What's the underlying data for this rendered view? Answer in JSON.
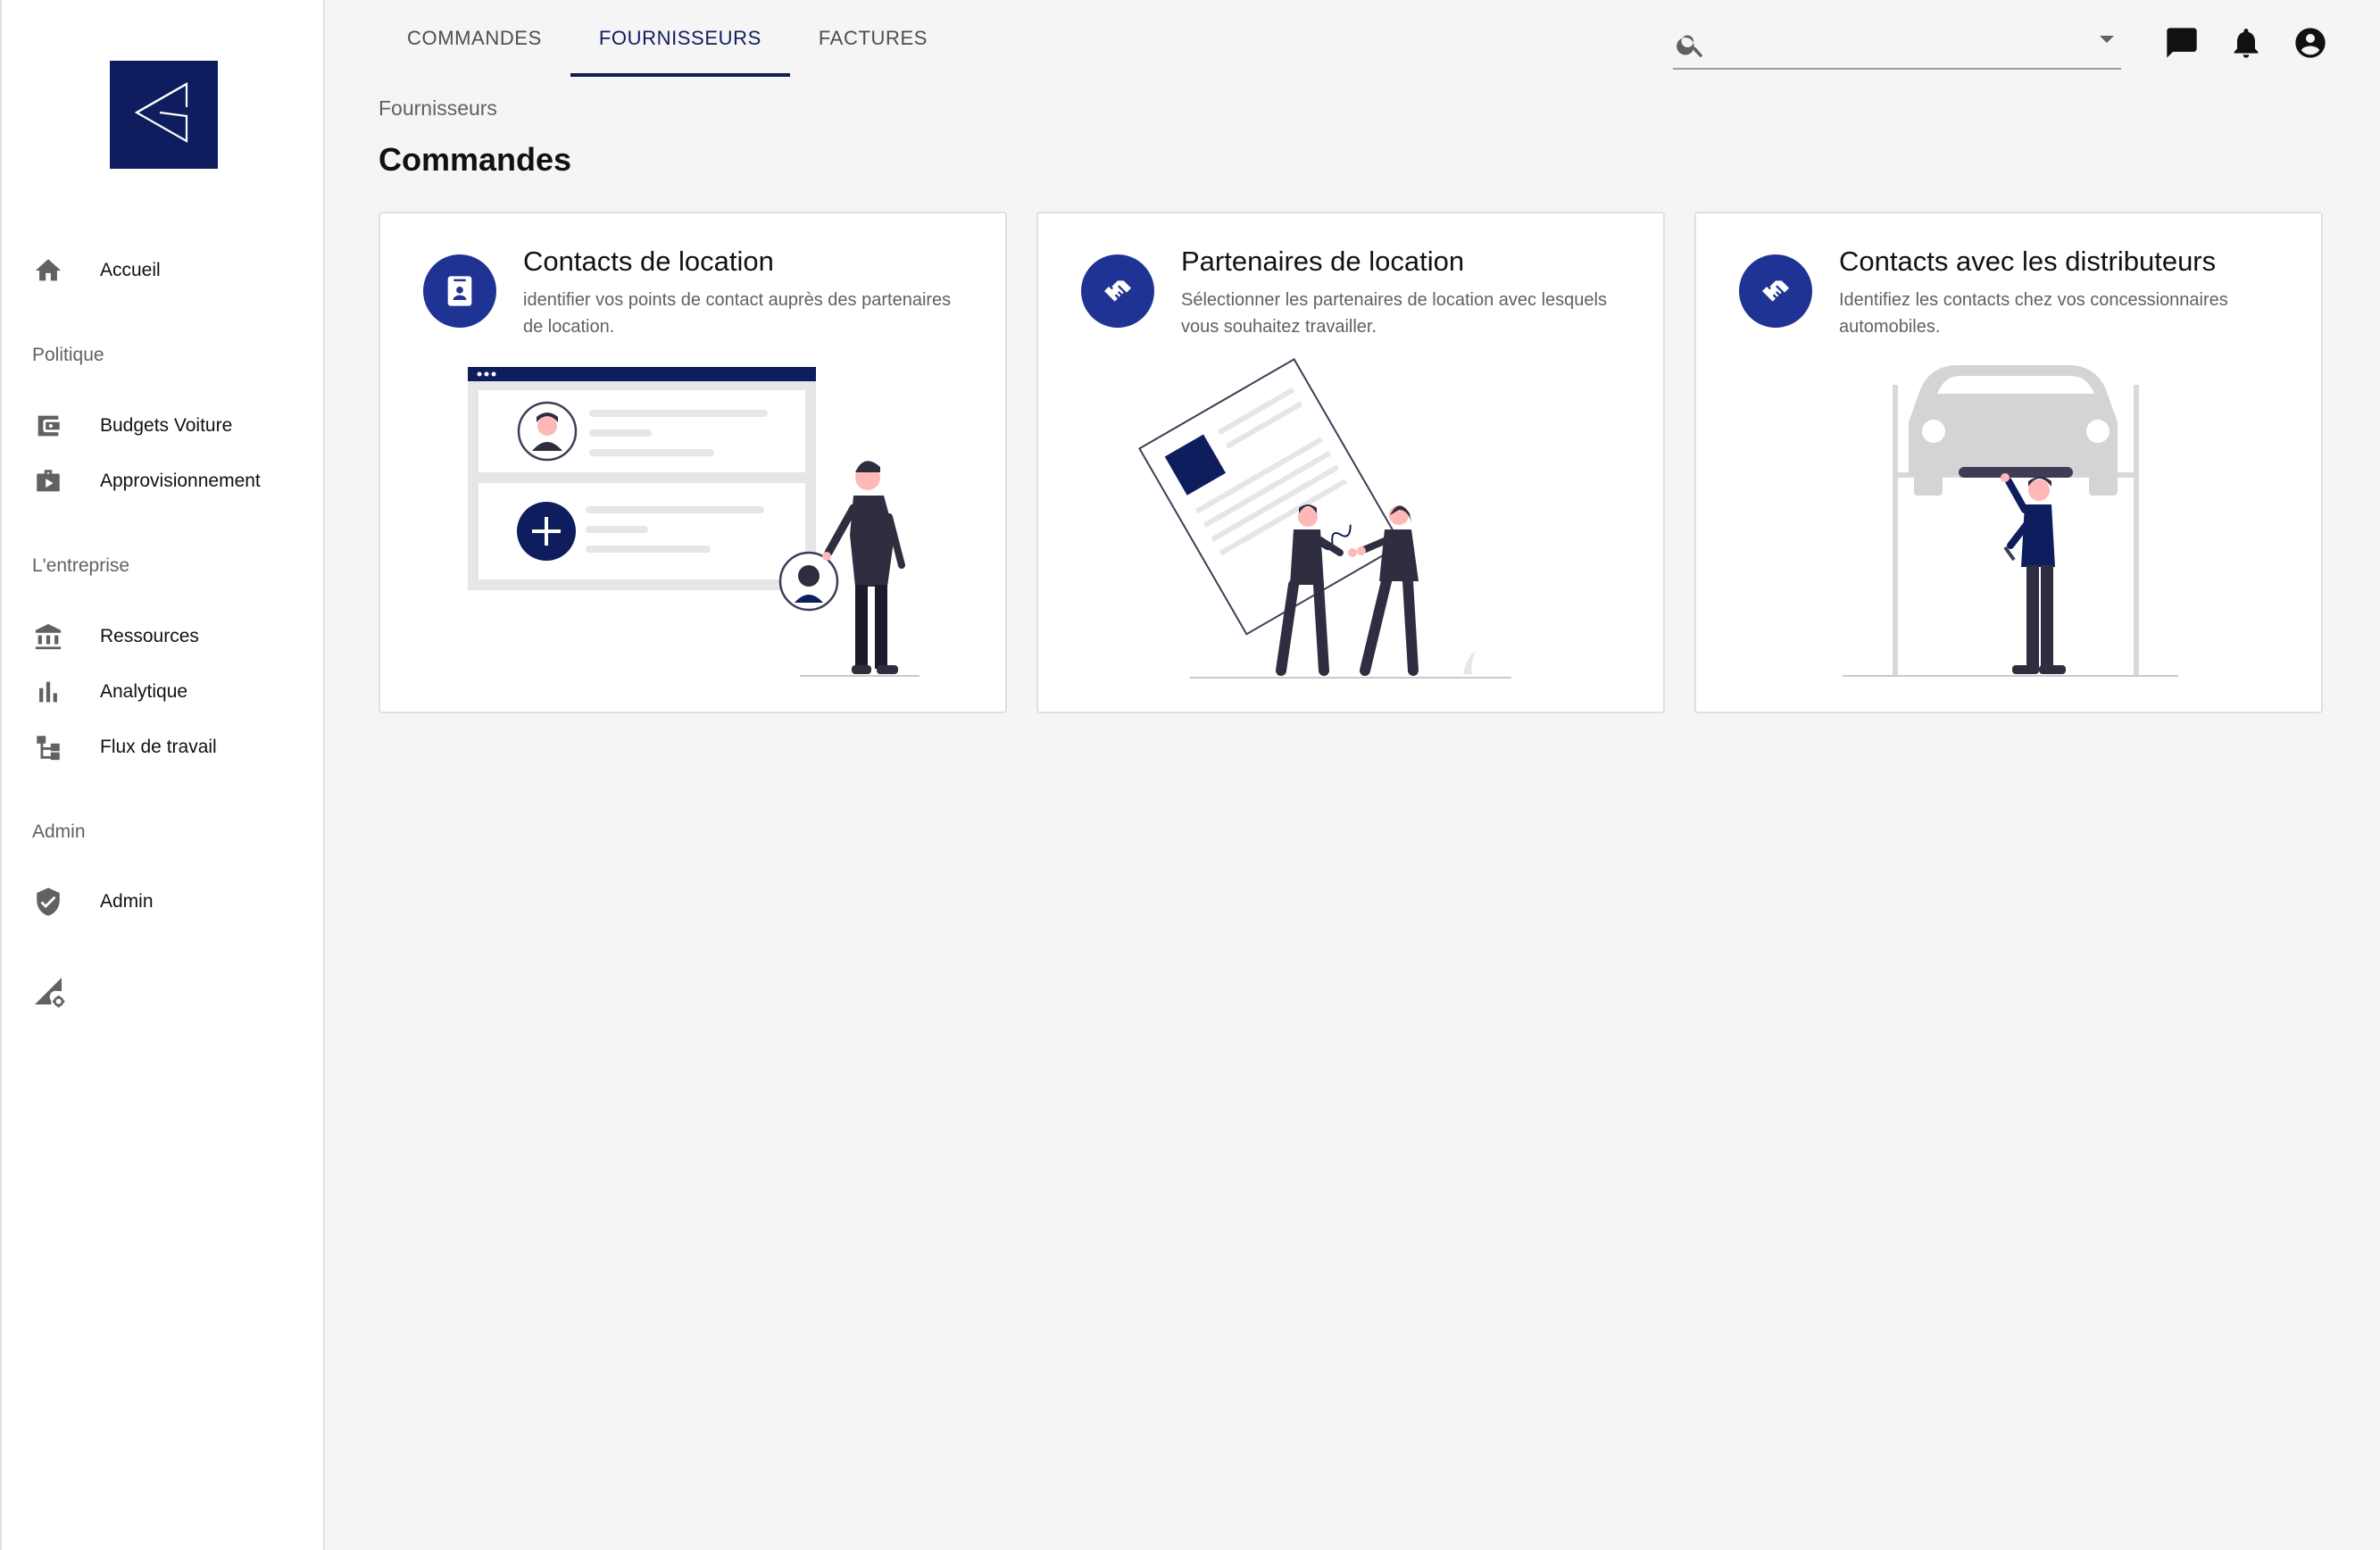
{
  "brand": {
    "logo": "company-logo",
    "color": "#0e1d5e"
  },
  "sidebar": {
    "items": [
      {
        "label": "Accueil",
        "icon": "home-icon"
      },
      {
        "label": "Budgets Voiture",
        "icon": "wallet-icon"
      },
      {
        "label": "Approvisionnement",
        "icon": "briefcase-play-icon"
      },
      {
        "label": "Ressources",
        "icon": "bank-icon"
      },
      {
        "label": "Analytique",
        "icon": "bar-chart-icon"
      },
      {
        "label": "Flux de travail",
        "icon": "workflow-icon"
      },
      {
        "label": "Admin",
        "icon": "shield-check-icon"
      }
    ],
    "sections": [
      "Politique",
      "L'entreprise",
      "Admin"
    ],
    "bottom_icon": "signal-settings-icon"
  },
  "tabs": [
    {
      "label": "COMMANDES",
      "active": false
    },
    {
      "label": "FOURNISSEURS",
      "active": true
    },
    {
      "label": "FACTURES",
      "active": false
    }
  ],
  "search": {
    "value": "",
    "placeholder": "",
    "icon": "search-icon"
  },
  "header_icons": [
    "chat-icon",
    "bell-icon",
    "account-circle-icon"
  ],
  "breadcrumb": "Fournisseurs",
  "page_title": "Commandes",
  "cards": [
    {
      "title": "Contacts de location",
      "description": "identifier vos points de contact auprès des partenaires de location.",
      "icon": "contact-card-icon"
    },
    {
      "title": "Partenaires de location",
      "description": "Sélectionner les partenaires de location avec lesquels vous souhaitez travailler.",
      "icon": "handshake-icon"
    },
    {
      "title": "Contacts avec les distributeurs",
      "description": "Identifiez les contacts chez vos concessionnaires automobiles.",
      "icon": "handshake-icon"
    }
  ],
  "colors": {
    "accent": "#0e1d5e",
    "badge": "#1f3394",
    "background": "#f5f5f5"
  }
}
